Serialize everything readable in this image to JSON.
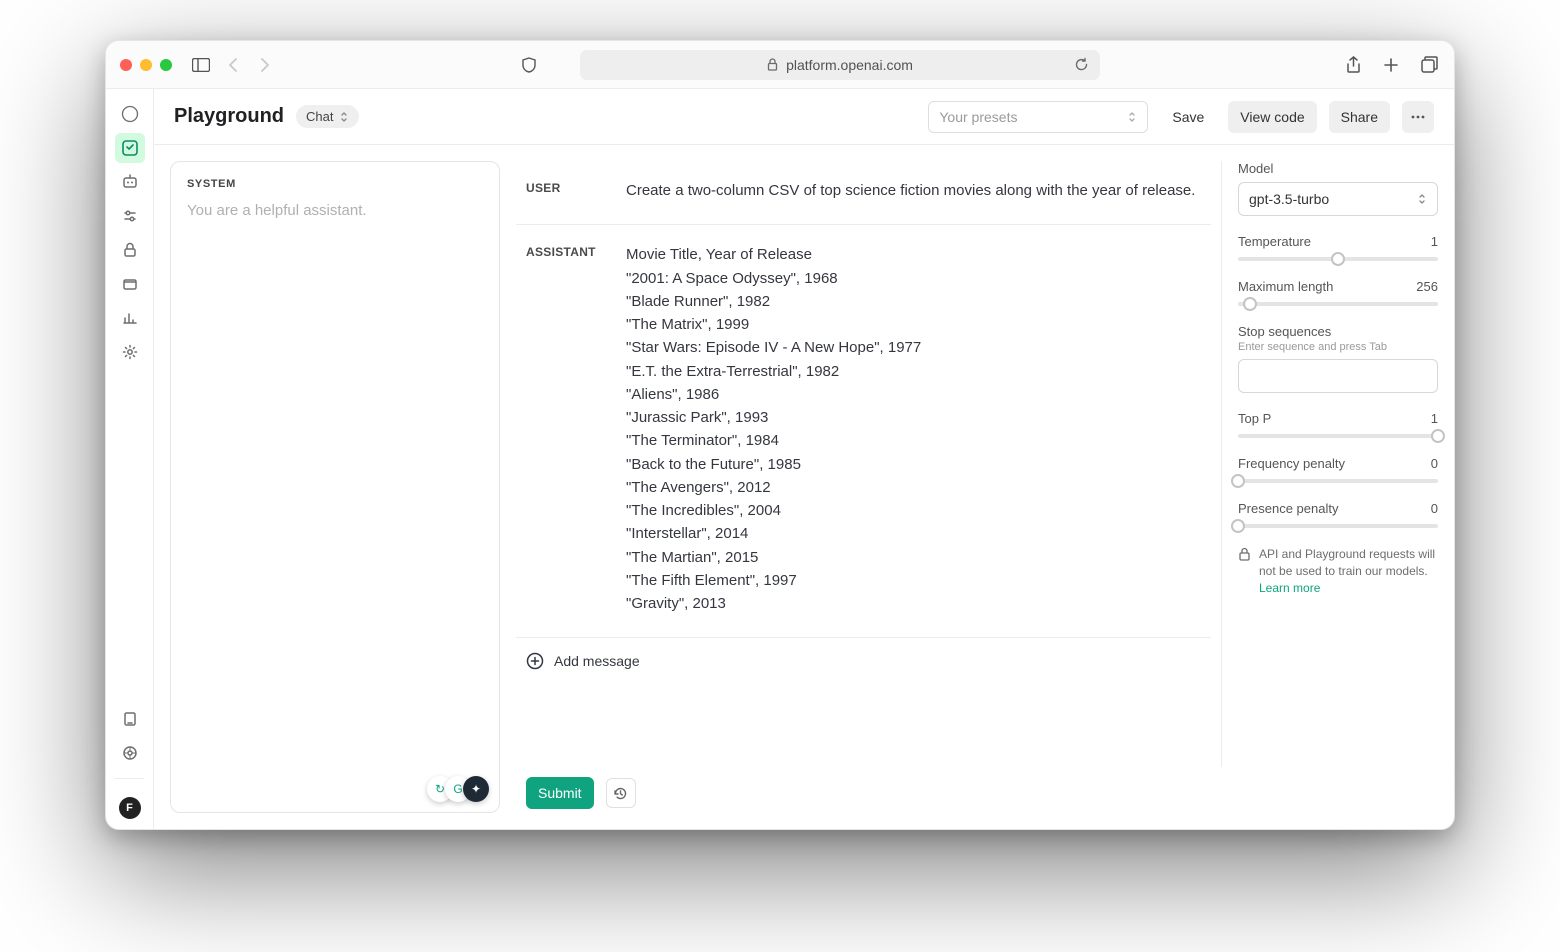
{
  "browser": {
    "url": "platform.openai.com"
  },
  "header": {
    "title": "Playground",
    "mode": "Chat",
    "preset_placeholder": "Your presets",
    "save": "Save",
    "view_code": "View code",
    "share": "Share"
  },
  "rail": {
    "avatar": "F"
  },
  "system": {
    "label": "SYSTEM",
    "placeholder": "You are a helpful assistant."
  },
  "chat": {
    "messages": [
      {
        "role": "USER",
        "content": "Create a two-column CSV of top science fiction movies along with the year of release."
      },
      {
        "role": "ASSISTANT",
        "content": "Movie Title, Year of Release\n\"2001: A Space Odyssey\", 1968\n\"Blade Runner\", 1982\n\"The Matrix\", 1999\n\"Star Wars: Episode IV - A New Hope\", 1977\n\"E.T. the Extra-Terrestrial\", 1982\n\"Aliens\", 1986\n\"Jurassic Park\", 1993\n\"The Terminator\", 1984\n\"Back to the Future\", 1985\n\"The Avengers\", 2012\n\"The Incredibles\", 2004\n\"Interstellar\", 2014\n\"The Martian\", 2015\n\"The Fifth Element\", 1997\n\"Gravity\", 2013"
      }
    ],
    "add_message": "Add message",
    "submit": "Submit"
  },
  "config": {
    "model_label": "Model",
    "model_value": "gpt-3.5-turbo",
    "temperature_label": "Temperature",
    "temperature_value": "1",
    "maxlen_label": "Maximum length",
    "maxlen_value": "256",
    "stop_label": "Stop sequences",
    "stop_hint": "Enter sequence and press Tab",
    "topp_label": "Top P",
    "topp_value": "1",
    "freq_label": "Frequency penalty",
    "freq_value": "0",
    "pres_label": "Presence penalty",
    "pres_value": "0",
    "notice": "API and Playground requests will not be used to train our models. ",
    "notice_link": "Learn more"
  }
}
